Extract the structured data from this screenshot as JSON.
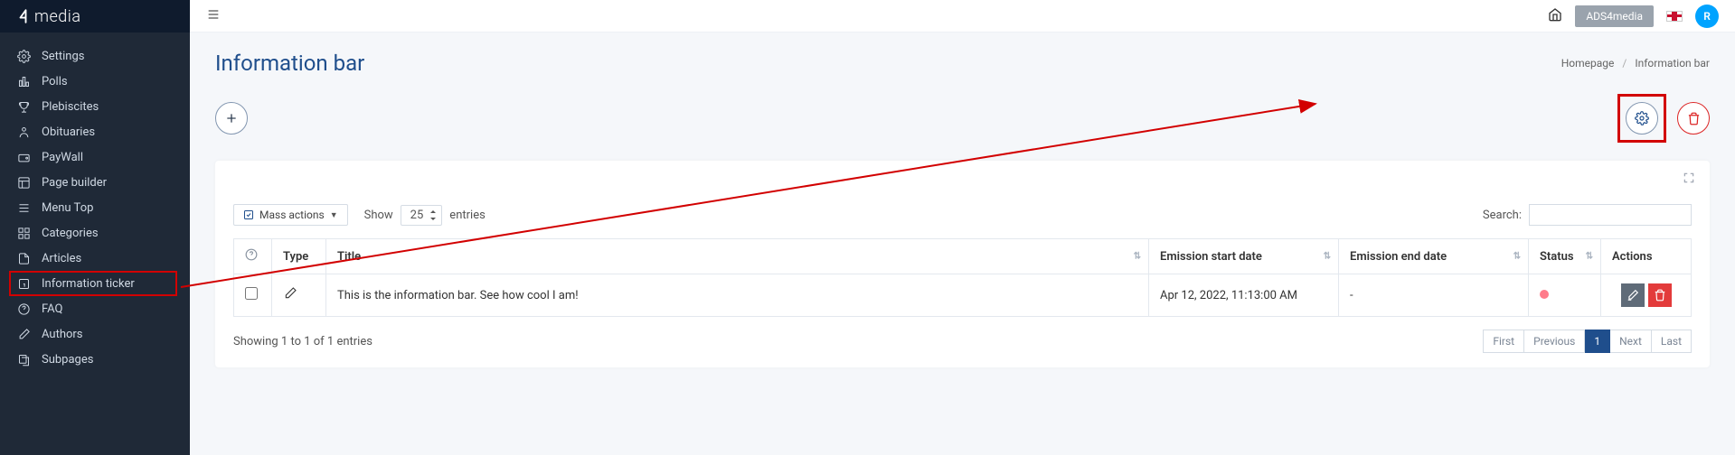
{
  "brand": {
    "bold": "4",
    "light": "media"
  },
  "sidebar": {
    "items": [
      {
        "label": "Settings"
      },
      {
        "label": "Polls"
      },
      {
        "label": "Plebiscites"
      },
      {
        "label": "Obituaries"
      },
      {
        "label": "PayWall"
      },
      {
        "label": "Page builder"
      },
      {
        "label": "Menu Top"
      },
      {
        "label": "Categories"
      },
      {
        "label": "Articles"
      },
      {
        "label": "Information ticker"
      },
      {
        "label": "FAQ"
      },
      {
        "label": "Authors"
      },
      {
        "label": "Subpages"
      }
    ]
  },
  "topbar": {
    "ads_label": "ADS4media",
    "avatar_initial": "R"
  },
  "page": {
    "title": "Information bar",
    "breadcrumb_home": "Homepage",
    "breadcrumb_current": "Information bar"
  },
  "controls": {
    "mass_actions": "Mass actions",
    "show": "Show",
    "entries": "entries",
    "page_size": "25",
    "search_label": "Search:"
  },
  "table": {
    "headers": {
      "type": "Type",
      "title": "Title",
      "start": "Emission start date",
      "end": "Emission end date",
      "status": "Status",
      "actions": "Actions"
    },
    "rows": [
      {
        "title": "This is the information bar. See how cool I am!",
        "start": "Apr 12, 2022, 11:13:00 AM",
        "end": "-"
      }
    ],
    "info": "Showing 1 to 1 of 1 entries",
    "pager": {
      "first": "First",
      "prev": "Previous",
      "page": "1",
      "next": "Next",
      "last": "Last"
    }
  }
}
